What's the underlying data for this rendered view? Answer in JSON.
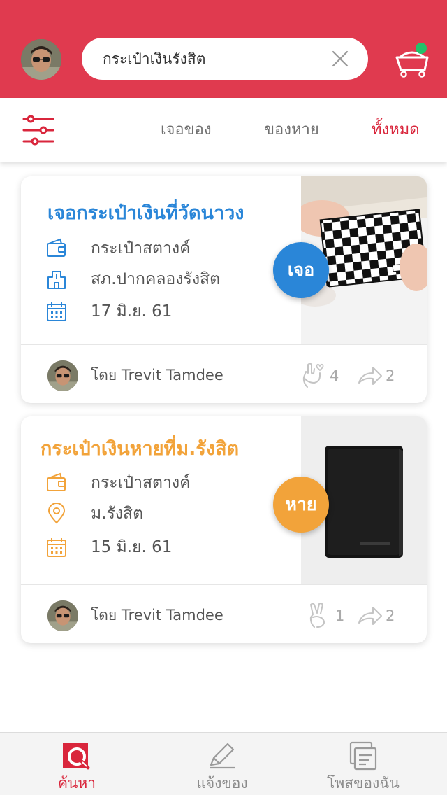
{
  "colors": {
    "brand_red": "#e03a4f",
    "active_red": "#d9263c",
    "found_blue": "#2a86d8",
    "lost_orange": "#f2a33a",
    "notification_dot": "#23c26a"
  },
  "header": {
    "search": {
      "value": "กระเป๋าเงินรังสิต",
      "clear_icon": "close-icon"
    },
    "cart_icon": "cart-icon"
  },
  "filterbar": {
    "filter_icon": "sliders-icon",
    "tabs": [
      {
        "label": "เจอของ",
        "active": false
      },
      {
        "label": "ของหาย",
        "active": false
      },
      {
        "label": "ทั้งหมด",
        "active": true
      }
    ]
  },
  "posts": [
    {
      "title": "เจอกระเป๋าเงินที่วัดนาวง",
      "type_label": "เจอ",
      "item_type": "กระเป๋าสตางค์",
      "place": "สภ.ปากคลองรังสิต",
      "date": "17 มิ.ย. 61",
      "author": "โดย  Trevit  Tamdee",
      "likes": "4",
      "shares": "2"
    },
    {
      "title": "กระเป๋าเงินหายที่ม.รังสิต",
      "type_label": "หาย",
      "item_type": "กระเป๋าสตางค์",
      "place": "ม.รังสิต",
      "date": "15 มิ.ย. 61",
      "author": "โดย  Trevit  Tamdee",
      "likes": "1",
      "shares": "2"
    }
  ],
  "bottom_nav": [
    {
      "label": "ค้นหา",
      "icon": "search-icon",
      "active": true
    },
    {
      "label": "แจ้งของ",
      "icon": "pencil-icon",
      "active": false
    },
    {
      "label": "โพสของฉัน",
      "icon": "my-posts-icon",
      "active": false
    }
  ]
}
